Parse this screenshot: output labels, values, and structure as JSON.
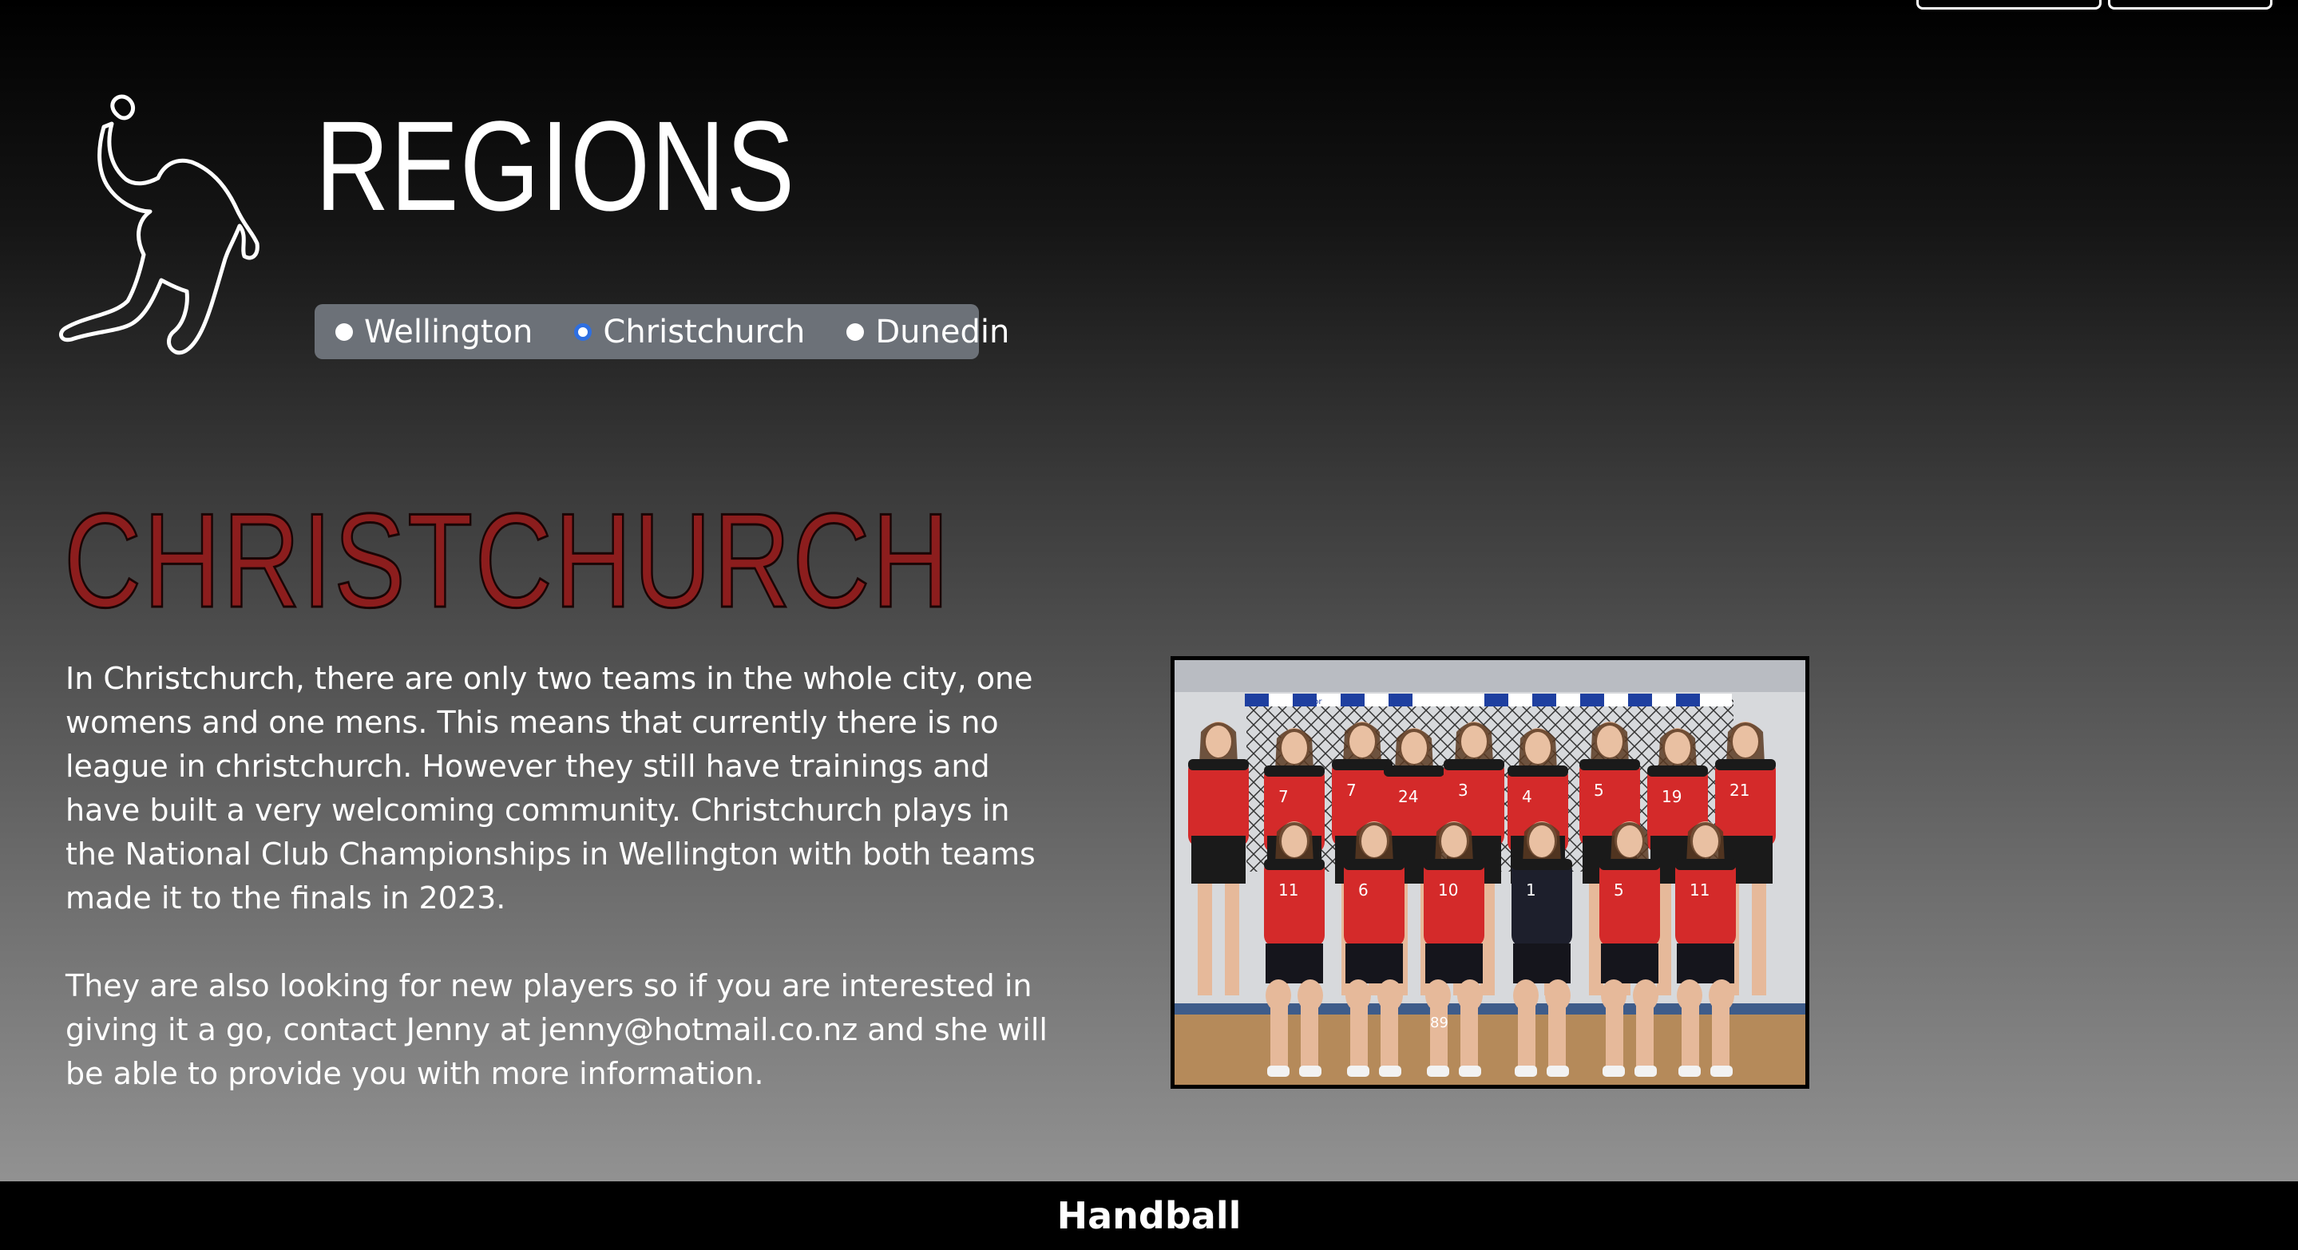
{
  "header": {
    "title": "REGIONS"
  },
  "region_selector": {
    "options": [
      {
        "label": "Wellington",
        "selected": false
      },
      {
        "label": "Christchurch",
        "selected": true
      },
      {
        "label": "Dunedin",
        "selected": false
      }
    ]
  },
  "region": {
    "heading": "CHRISTCHURCH",
    "paragraphs": [
      "In Christchurch, there are only two teams in the whole city, one womens and one mens. This means that currently there is no league in christchurch. However they still have trainings and have built a very welcoming community. Christchurch plays in the National Club Championships in Wellington with both teams made it to the finals in 2023.",
      "They are also looking for new players so if you are interested in giving it a go, contact Jenny at jenny@hotmail.co.nz and she will be able to provide you with more information."
    ]
  },
  "photo": {
    "jersey_numbers_back": [
      "7",
      "7",
      "24",
      "3",
      "4",
      "5",
      "19",
      "21"
    ],
    "jersey_numbers_front": [
      "11",
      "6",
      "10",
      "1",
      "5",
      "11"
    ],
    "shorts_number": "89",
    "goal_sign": "Gerflor"
  },
  "footer": {
    "title": "Handball"
  },
  "colors": {
    "heading_red": "#8c1d1d",
    "selector_bg": "#6c7178",
    "radio_selected": "#2f6fe0",
    "jersey_red": "#d42a2a"
  },
  "icons": {
    "logo": "handball-player-icon"
  }
}
